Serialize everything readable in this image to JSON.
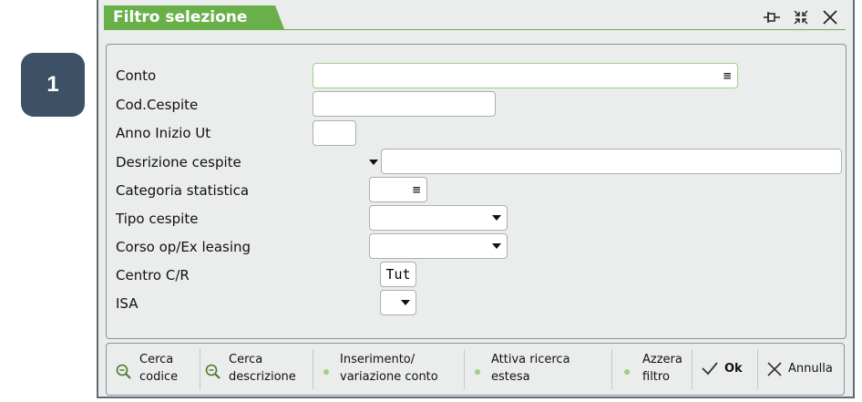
{
  "step_badge": "1",
  "window": {
    "title": "Filtro selezione"
  },
  "fields": {
    "conto": {
      "label": "Conto",
      "value": ""
    },
    "cod_cespite": {
      "label": "Cod.Cespite",
      "value": ""
    },
    "anno_inizio": {
      "label": "Anno Inizio Ut",
      "value": ""
    },
    "descrizione": {
      "label": "Desrizione cespite",
      "value": ""
    },
    "categoria": {
      "label": "Categoria statistica",
      "value": ""
    },
    "tipo_cespite": {
      "label": "Tipo cespite",
      "value": ""
    },
    "corso_op": {
      "label": "Corso op/Ex leasing",
      "value": ""
    },
    "centro_cr": {
      "label": "Centro C/R",
      "value": "Tut"
    },
    "isa": {
      "label": "ISA",
      "value": ""
    }
  },
  "toolbar": {
    "cerca_codice": [
      "Cerca",
      "codice"
    ],
    "cerca_descrizione": [
      "Cerca",
      "descrizione"
    ],
    "inserimento": [
      "Inserimento/",
      "variazione conto"
    ],
    "attiva_ricerca": [
      "Attiva ricerca",
      "estesa"
    ],
    "azzera": [
      "Azzera",
      "filtro"
    ],
    "ok": "Ok",
    "annulla": "Annulla"
  },
  "icons": {
    "pin": "pin-icon",
    "maximize": "compress-icon",
    "close": "close-icon",
    "search": "magnifier-icon",
    "ok": "checkmark-icon",
    "cancel": "x-icon"
  },
  "colors": {
    "accent": "#6ab04a",
    "badge": "#3d5166",
    "background": "#ebecec"
  }
}
